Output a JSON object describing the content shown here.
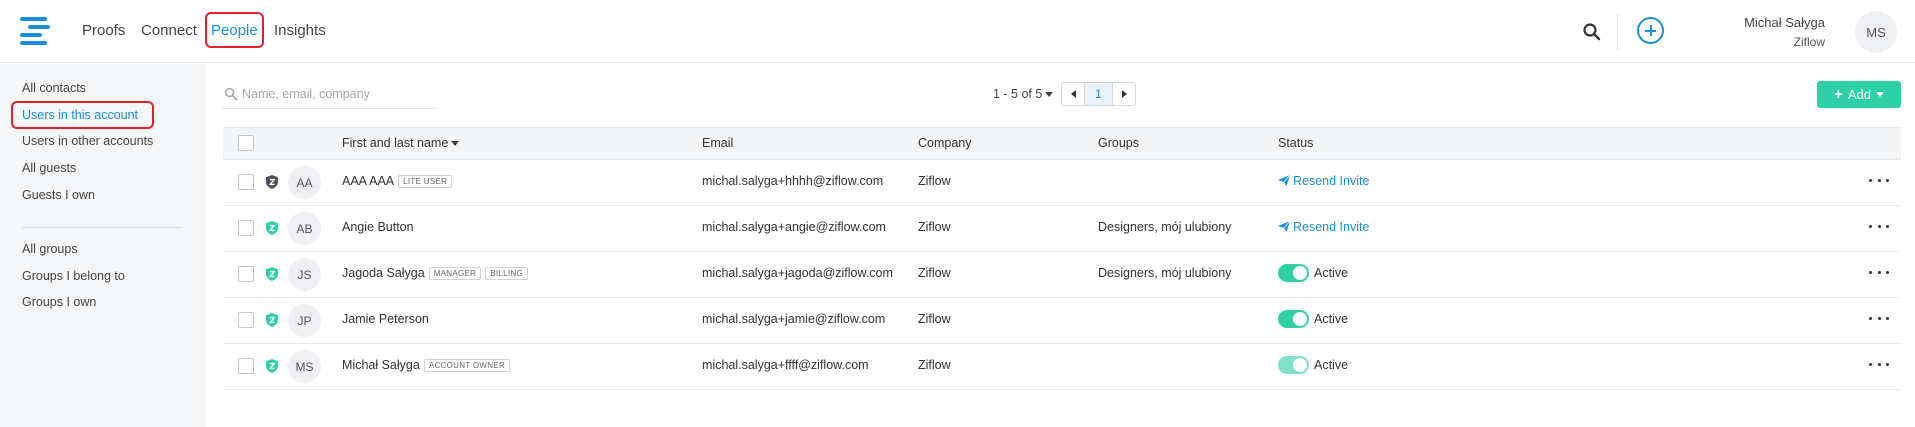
{
  "nav": {
    "items": [
      "Proofs",
      "Connect",
      "People",
      "Insights"
    ],
    "active": "People"
  },
  "user": {
    "name": "Michał Sałyga",
    "org": "Ziflow",
    "initials": "MS"
  },
  "sidebar": {
    "contacts": [
      "All contacts",
      "Users in this account",
      "Users in other accounts",
      "All guests",
      "Guests I own"
    ],
    "groups": [
      "All groups",
      "Groups I belong to",
      "Groups I own"
    ],
    "active": "Users in this account"
  },
  "search": {
    "placeholder": "Name, email, company"
  },
  "pager": {
    "range": "1 - 5 of 5",
    "current_page": "1"
  },
  "add_button": {
    "label": "Add"
  },
  "table": {
    "headers": {
      "name": "First and last name",
      "email": "Email",
      "company": "Company",
      "groups": "Groups",
      "status": "Status"
    },
    "rows": [
      {
        "initials": "AA",
        "name": "AAA AAA",
        "badges": [
          "LITE USER"
        ],
        "email": "michal.salyga+hhhh@ziflow.com",
        "company": "Ziflow",
        "groups": "",
        "status": "Resend Invite",
        "shield_color": "#4a5158"
      },
      {
        "initials": "AB",
        "name": "Angie Button",
        "badges": [],
        "email": "michal.salyga+angie@ziflow.com",
        "company": "Ziflow",
        "groups": "Designers, mój ulubiony",
        "status": "Resend Invite",
        "shield_color": "#2fd0a8"
      },
      {
        "initials": "JS",
        "name": "Jagoda Sałyga",
        "badges": [
          "MANAGER",
          "BILLING"
        ],
        "email": "michal.salyga+jagoda@ziflow.com",
        "company": "Ziflow",
        "groups": "Designers, mój ulubiony",
        "status": "Active",
        "shield_color": "#2fd0a8"
      },
      {
        "initials": "JP",
        "name": "Jamie Peterson",
        "badges": [],
        "email": "michal.salyga+jamie@ziflow.com",
        "company": "Ziflow",
        "groups": "",
        "status": "Active",
        "shield_color": "#2fd0a8"
      },
      {
        "initials": "MS",
        "name": "Michał Sałyga",
        "badges": [
          "ACCOUNT OWNER"
        ],
        "email": "michal.salyga+ffff@ziflow.com",
        "company": "Ziflow",
        "groups": "",
        "status": "Active",
        "shield_color": "#2fd0a8"
      }
    ]
  },
  "colors": {
    "accent": "#1a8fd9",
    "primary_green": "#2fd0a8",
    "highlight_red": "#e0232a"
  }
}
